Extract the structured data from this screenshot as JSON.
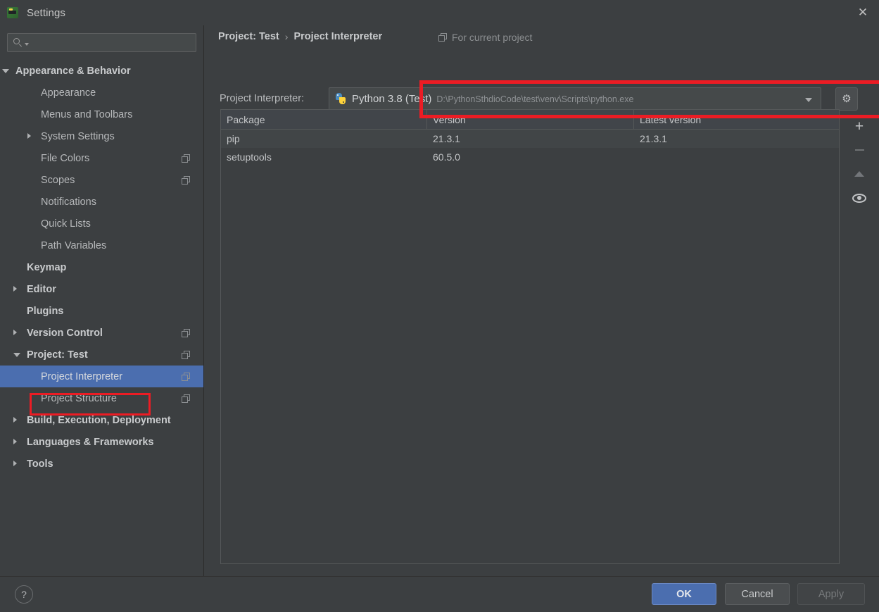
{
  "window": {
    "title": "Settings",
    "app_icon": "pycharm-icon",
    "close_icon": "close-icon"
  },
  "sidebar": {
    "search": {
      "placeholder": "",
      "value": "",
      "icon": "search-icon",
      "caret_icon": "chevron-down-icon"
    },
    "items": [
      {
        "label": "Appearance & Behavior",
        "indent": 22,
        "arrow": "down",
        "bold": true,
        "copy": false,
        "selected": false
      },
      {
        "label": "Appearance",
        "indent": 58,
        "arrow": "none",
        "bold": false,
        "copy": false,
        "selected": false
      },
      {
        "label": "Menus and Toolbars",
        "indent": 58,
        "arrow": "none",
        "bold": false,
        "copy": false,
        "selected": false
      },
      {
        "label": "System Settings",
        "indent": 58,
        "arrow": "right",
        "bold": false,
        "copy": false,
        "selected": false
      },
      {
        "label": "File Colors",
        "indent": 58,
        "arrow": "none",
        "bold": false,
        "copy": true,
        "selected": false
      },
      {
        "label": "Scopes",
        "indent": 58,
        "arrow": "none",
        "bold": false,
        "copy": true,
        "selected": false
      },
      {
        "label": "Notifications",
        "indent": 58,
        "arrow": "none",
        "bold": false,
        "copy": false,
        "selected": false
      },
      {
        "label": "Quick Lists",
        "indent": 58,
        "arrow": "none",
        "bold": false,
        "copy": false,
        "selected": false
      },
      {
        "label": "Path Variables",
        "indent": 58,
        "arrow": "none",
        "bold": false,
        "copy": false,
        "selected": false
      },
      {
        "label": "Keymap",
        "indent": 38,
        "arrow": "none",
        "bold": true,
        "copy": false,
        "selected": false
      },
      {
        "label": "Editor",
        "indent": 38,
        "arrow": "right",
        "bold": true,
        "copy": false,
        "selected": false
      },
      {
        "label": "Plugins",
        "indent": 38,
        "arrow": "none",
        "bold": true,
        "copy": false,
        "selected": false
      },
      {
        "label": "Version Control",
        "indent": 38,
        "arrow": "right",
        "bold": true,
        "copy": true,
        "selected": false
      },
      {
        "label": "Project: Test",
        "indent": 38,
        "arrow": "down",
        "bold": true,
        "copy": true,
        "selected": false
      },
      {
        "label": "Project Interpreter",
        "indent": 58,
        "arrow": "none",
        "bold": false,
        "copy": true,
        "selected": true
      },
      {
        "label": "Project Structure",
        "indent": 58,
        "arrow": "none",
        "bold": false,
        "copy": true,
        "selected": false
      },
      {
        "label": "Build, Execution, Deployment",
        "indent": 38,
        "arrow": "right",
        "bold": true,
        "copy": false,
        "selected": false
      },
      {
        "label": "Languages & Frameworks",
        "indent": 38,
        "arrow": "right",
        "bold": true,
        "copy": false,
        "selected": false
      },
      {
        "label": "Tools",
        "indent": 38,
        "arrow": "right",
        "bold": true,
        "copy": false,
        "selected": false
      }
    ]
  },
  "main": {
    "breadcrumb": {
      "root": "Project: Test",
      "separator": "›",
      "leaf": "Project Interpreter"
    },
    "for_current_project": {
      "label": "For current project",
      "icon": "copy-icon"
    },
    "interpreter": {
      "label": "Project Interpreter:",
      "icon": "python-icon",
      "name": "Python 3.8 (Test)",
      "path": "D:\\PythonSthdioCode\\test\\venv\\Scripts\\python.exe",
      "dropdown_icon": "chevron-down-icon",
      "settings_button": {
        "icon": "gear-icon",
        "glyph": "⚙"
      }
    },
    "packages_table": {
      "columns": [
        "Package",
        "Version",
        "Latest version"
      ],
      "rows": [
        {
          "package": "pip",
          "version": "21.3.1",
          "latest": "21.3.1"
        },
        {
          "package": "setuptools",
          "version": "60.5.0",
          "latest": ""
        }
      ]
    },
    "table_tools": [
      {
        "name": "add-package-button",
        "icon": "plus-icon",
        "enabled": true
      },
      {
        "name": "remove-package-button",
        "icon": "minus-icon",
        "enabled": false
      },
      {
        "name": "upgrade-package-button",
        "icon": "up-arrow-icon",
        "enabled": false
      },
      {
        "name": "show-early-releases-button",
        "icon": "eye-icon",
        "enabled": true
      }
    ]
  },
  "footer": {
    "help": {
      "label": "?",
      "name": "help-button"
    },
    "ok": "OK",
    "cancel": "Cancel",
    "apply": "Apply"
  },
  "annotations": {
    "highlight_color": "#ec1c24",
    "boxes": [
      "interpreter-row",
      "sidebar-project-interpreter"
    ]
  },
  "colors": {
    "background": "#3c3f41",
    "selection": "#4b6eaf",
    "accent_button": "#4b6eaf",
    "highlight": "#ec1c24"
  }
}
